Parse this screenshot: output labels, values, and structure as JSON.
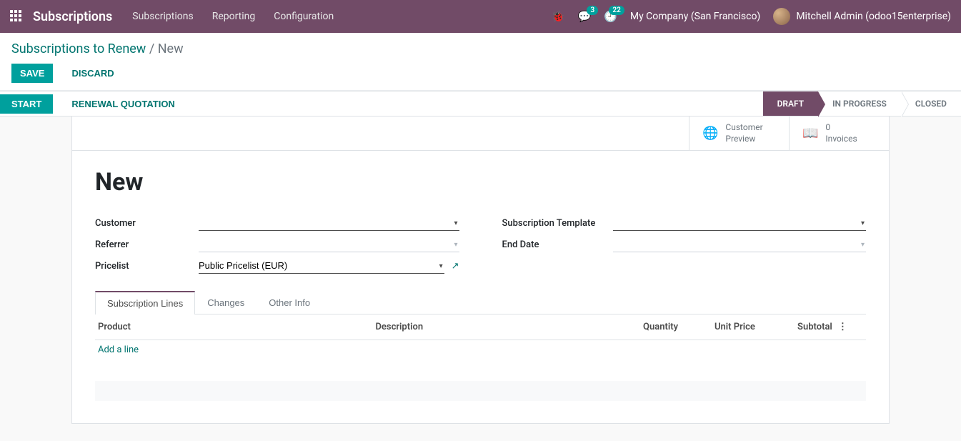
{
  "navbar": {
    "app_title": "Subscriptions",
    "menu": [
      "Subscriptions",
      "Reporting",
      "Configuration"
    ],
    "messages_count": "3",
    "activities_count": "22",
    "company": "My Company (San Francisco)",
    "user": "Mitchell Admin (odoo15enterprise)"
  },
  "breadcrumb": {
    "parent": "Subscriptions to Renew",
    "current": "New"
  },
  "control": {
    "save": "SAVE",
    "discard": "DISCARD"
  },
  "statusbar": {
    "start": "START",
    "renewal": "RENEWAL QUOTATION",
    "stages": [
      "DRAFT",
      "IN PROGRESS",
      "CLOSED"
    ],
    "active_index": 0
  },
  "stat_buttons": {
    "preview_l1": "Customer",
    "preview_l2": "Preview",
    "invoices_l1": "0",
    "invoices_l2": "Invoices"
  },
  "record": {
    "title": "New",
    "fields": {
      "customer_label": "Customer",
      "customer_value": "",
      "referrer_label": "Referrer",
      "referrer_value": "",
      "pricelist_label": "Pricelist",
      "pricelist_value": "Public Pricelist (EUR)",
      "template_label": "Subscription Template",
      "template_value": "",
      "end_date_label": "End Date",
      "end_date_value": ""
    }
  },
  "tabs": {
    "items": [
      "Subscription Lines",
      "Changes",
      "Other Info"
    ],
    "active_index": 0
  },
  "table": {
    "headers": {
      "product": "Product",
      "description": "Description",
      "quantity": "Quantity",
      "unit_price": "Unit Price",
      "subtotal": "Subtotal"
    },
    "add_line": "Add a line",
    "rows": []
  }
}
